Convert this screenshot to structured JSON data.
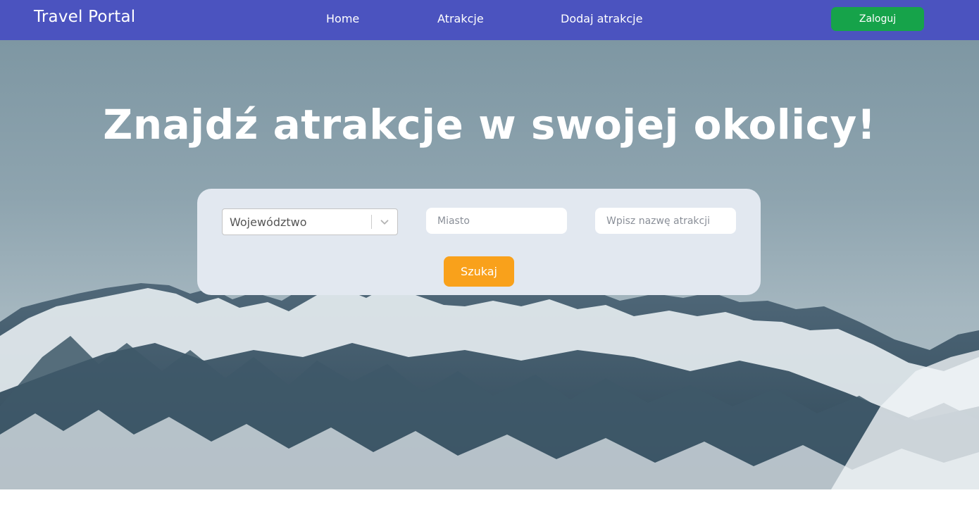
{
  "navbar": {
    "brand": "Travel Portal",
    "links": [
      "Home",
      "Atrakcje",
      "Dodaj atrakcje"
    ],
    "login_label": "Zaloguj"
  },
  "hero": {
    "title": "Znajdź atrakcje w swojej okolicy!"
  },
  "search": {
    "region_select_value": "Województwo",
    "city_placeholder": "Miasto",
    "attraction_placeholder": "Wpisz nazwę atrakcji",
    "search_label": "Szukaj"
  },
  "colors": {
    "navbar_bg": "#4b53bf",
    "login_green": "#16a34a",
    "search_orange": "#f9a11b",
    "panel_bg": "#e2e8f0"
  }
}
